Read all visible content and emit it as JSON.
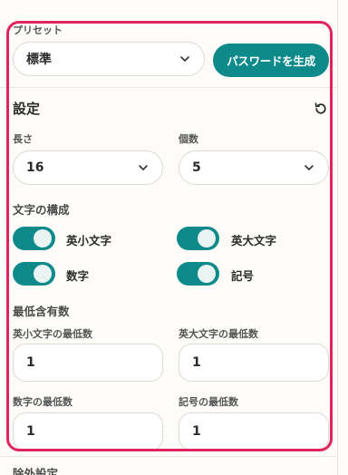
{
  "preset": {
    "label": "プリセット",
    "selected": "標準",
    "generate_button": "パスワードを生成"
  },
  "settings": {
    "title": "設定",
    "length_label": "長さ",
    "length_value": "16",
    "count_label": "個数",
    "count_value": "5"
  },
  "composition": {
    "title": "文字の構成",
    "toggles": [
      {
        "label": "英小文字",
        "on": true
      },
      {
        "label": "英大文字",
        "on": true
      },
      {
        "label": "数字",
        "on": true
      },
      {
        "label": "記号",
        "on": true
      }
    ]
  },
  "minimums": {
    "title": "最低含有数",
    "fields": [
      {
        "label": "英小文字の最低数",
        "value": "1"
      },
      {
        "label": "英大文字の最低数",
        "value": "1"
      },
      {
        "label": "数字の最低数",
        "value": "1"
      },
      {
        "label": "記号の最低数",
        "value": "1"
      }
    ]
  },
  "exclusion": {
    "title": "除外設定"
  },
  "colors": {
    "accent": "#0e8a8a",
    "highlight_border": "#e0245e"
  }
}
